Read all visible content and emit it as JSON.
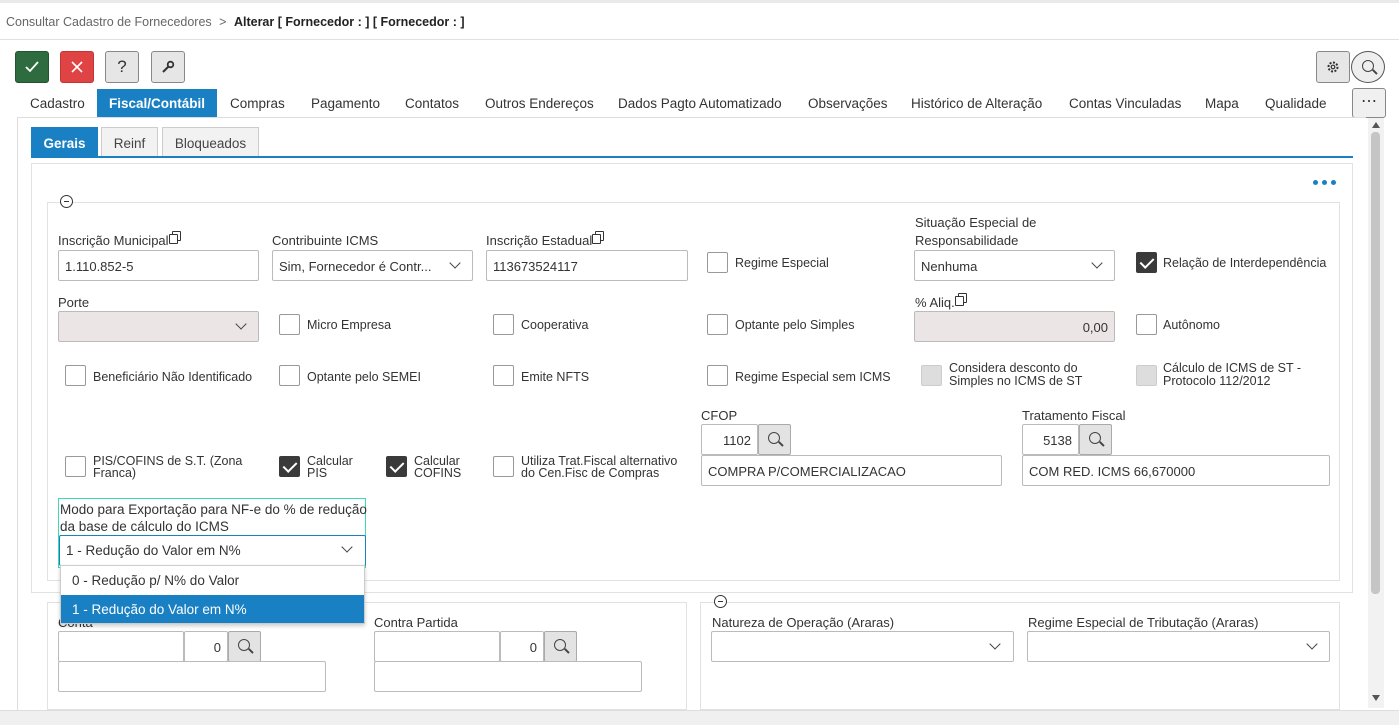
{
  "breadcrumb": {
    "parent": "Consultar Cadastro de Fornecedores",
    "sep": ">",
    "current": "Alterar [ Fornecedor : ] [ Fornecedor : ]"
  },
  "toolbar": {
    "confirm_icon": "check-icon",
    "cancel_icon": "close-icon",
    "help_label": "?",
    "tools_icon": "wrench-icon",
    "settings_icon": "gear-icon",
    "search_icon": "search-icon"
  },
  "tabs": [
    "Cadastro",
    "Fiscal/Contábil",
    "Compras",
    "Pagamento",
    "Contatos",
    "Outros Endereços",
    "Dados Pagto Automatizado",
    "Observações",
    "Histórico de Alteração",
    "Contas Vinculadas",
    "Mapa",
    "Qualidade"
  ],
  "active_tab": "Fiscal/Contábil",
  "more_label": "⋯",
  "subtabs": [
    "Gerais",
    "Reinf",
    "Bloqueados"
  ],
  "form": {
    "inscricao_municipal": {
      "label": "Inscrição Municipal",
      "value": "1.110.852-5"
    },
    "contribuinte_icms": {
      "label": "Contribuinte ICMS",
      "value": "Sim, Fornecedor é Contr..."
    },
    "inscricao_estadual": {
      "label": "Inscrição Estadual",
      "value": "113673524117"
    },
    "regime_especial": {
      "label": "Regime Especial",
      "checked": false
    },
    "situacao_especial": {
      "label_1": "Situação Especial de",
      "label_2": "Responsabilidade",
      "value": "Nenhuma"
    },
    "relacao_interdependencia": {
      "label": "Relação de Interdependência",
      "checked": true
    },
    "porte": {
      "label": "Porte",
      "value": ""
    },
    "micro_empresa": {
      "label": "Micro Empresa",
      "checked": false
    },
    "cooperativa": {
      "label": "Cooperativa",
      "checked": false
    },
    "optante_simples": {
      "label": "Optante pelo Simples",
      "checked": false
    },
    "aliq": {
      "label": "% Aliq.",
      "value": "0,00"
    },
    "autonomo": {
      "label": "Autônomo",
      "checked": false
    },
    "beneficiario": {
      "label": "Beneficiário Não Identificado",
      "checked": false
    },
    "optante_semei": {
      "label": "Optante pelo SEMEI",
      "checked": false
    },
    "emite_nfts": {
      "label": "Emite NFTS",
      "checked": false
    },
    "regime_sem_icms": {
      "label": "Regime Especial sem ICMS",
      "checked": false
    },
    "considera_desconto": {
      "label_1": "Considera desconto do",
      "label_2": "Simples no ICMS de ST",
      "checked": false
    },
    "calculo_icms_st": {
      "label_1": "Cálculo de ICMS de ST -",
      "label_2": "Protocolo 112/2012",
      "checked": false
    },
    "cfop": {
      "label": "CFOP",
      "code": "1102",
      "description": "COMPRA P/COMERCIALIZACAO"
    },
    "tratamento_fiscal": {
      "label": "Tratamento Fiscal",
      "code": "5138",
      "description": "COM RED. ICMS 66,670000"
    },
    "pis_cofins_st": {
      "label_1": "PIS/COFINS de S.T. (Zona",
      "label_2": "Franca)",
      "checked": false
    },
    "calcular_pis": {
      "label_1": "Calcular",
      "label_2": "PIS",
      "checked": true
    },
    "calcular_cofins": {
      "label_1": "Calcular",
      "label_2": "COFINS",
      "checked": true
    },
    "utiliza_trat": {
      "label_1": "Utiliza Trat.Fiscal alternativo",
      "label_2": "do Cen.Fisc de Compras",
      "checked": false
    },
    "modo_exportacao": {
      "label_1": "Modo para Exportação para NF-e do % de redução",
      "label_2": "da base de cálculo do ICMS",
      "value": "1 - Redução do Valor em N%",
      "options": [
        "0 - Redução p/ N% do Valor",
        "1 - Redução do Valor em N%"
      ]
    }
  },
  "lower": {
    "conta": {
      "label": "Conta",
      "code": "0"
    },
    "contra_partida": {
      "label": "Contra Partida",
      "code": "0"
    },
    "natureza": {
      "label": "Natureza de Operação (Araras)",
      "value": ""
    },
    "regime_tributacao": {
      "label": "Regime Especial de Tributação (Araras)",
      "value": ""
    }
  },
  "colors": {
    "accent": "#1a80c4",
    "confirm": "#2e6b3e",
    "cancel": "#e04343",
    "selected_option": "#1a80c4",
    "focus_border": "#3dd9b3"
  }
}
